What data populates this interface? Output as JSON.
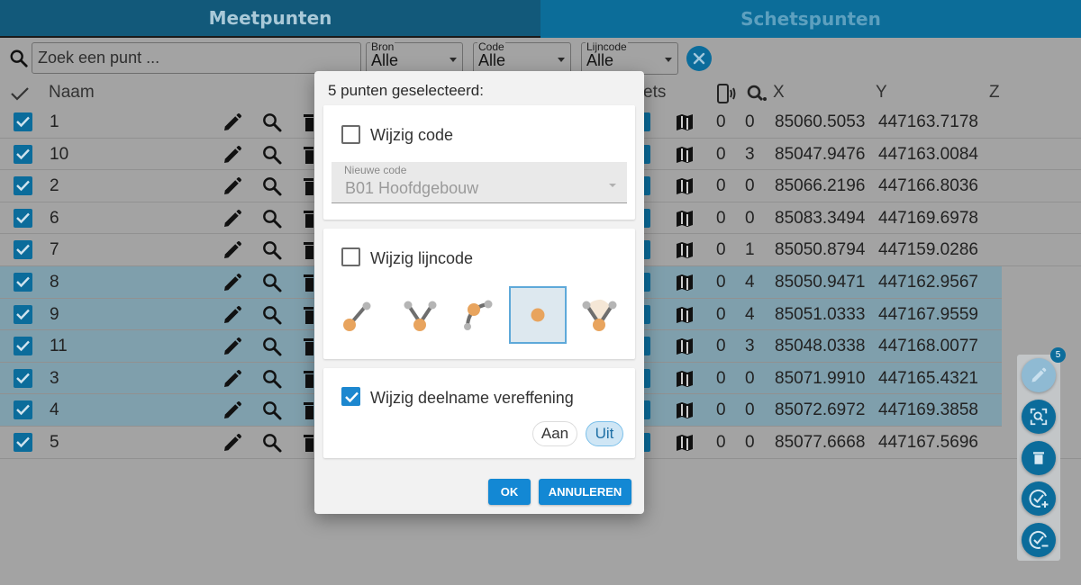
{
  "tabs": [
    {
      "label": "Meetpunten",
      "active": true
    },
    {
      "label": "Schetspunten",
      "active": false
    }
  ],
  "filters": {
    "search_placeholder": "Zoek een punt ...",
    "bron": {
      "label": "Bron",
      "value": "Alle"
    },
    "code": {
      "label": "Code",
      "value": "Alle"
    },
    "lijncode": {
      "label": "Lijncode",
      "value": "Alle"
    }
  },
  "table": {
    "headers": {
      "naam": "Naam",
      "schets_partial": "ets",
      "x": "X",
      "y": "Y",
      "z": "Z"
    },
    "rows": [
      {
        "naam": "1",
        "c0": "0",
        "c1": "0",
        "x": "85060.5053",
        "y": "447163.7178",
        "selected": false
      },
      {
        "naam": "10",
        "c0": "0",
        "c1": "3",
        "x": "85047.9476",
        "y": "447163.0084",
        "selected": false
      },
      {
        "naam": "2",
        "c0": "0",
        "c1": "0",
        "x": "85066.2196",
        "y": "447166.8036",
        "selected": false
      },
      {
        "naam": "6",
        "c0": "0",
        "c1": "0",
        "x": "85083.3494",
        "y": "447169.6978",
        "selected": false
      },
      {
        "naam": "7",
        "c0": "0",
        "c1": "1",
        "x": "85050.8794",
        "y": "447159.0286",
        "selected": false
      },
      {
        "naam": "8",
        "c0": "0",
        "c1": "4",
        "x": "85050.9471",
        "y": "447162.9567",
        "selected": true
      },
      {
        "naam": "9",
        "c0": "0",
        "c1": "4",
        "x": "85051.0333",
        "y": "447167.9559",
        "selected": true
      },
      {
        "naam": "11",
        "c0": "0",
        "c1": "3",
        "x": "85048.0338",
        "y": "447168.0077",
        "selected": true
      },
      {
        "naam": "3",
        "c0": "0",
        "c1": "0",
        "x": "85071.9910",
        "y": "447165.4321",
        "selected": true
      },
      {
        "naam": "4",
        "c0": "0",
        "c1": "0",
        "x": "85072.6972",
        "y": "447169.3858",
        "selected": true
      },
      {
        "naam": "5",
        "c0": "0",
        "c1": "0",
        "x": "85077.6668",
        "y": "447167.5696",
        "selected": false
      }
    ]
  },
  "dialog": {
    "title": "5 punten geselecteerd:",
    "wijzig_code": {
      "label": "Wijzig code",
      "checked": false
    },
    "nieuwe_code": {
      "label": "Nieuwe code",
      "value": "B01 Hoofdgebouw"
    },
    "wijzig_lijncode": {
      "label": "Wijzig lijncode",
      "checked": false
    },
    "lijncode_options": [
      "line-end-icon",
      "line-middle-icon",
      "arc-icon",
      "point-icon",
      "fan-icon"
    ],
    "lijncode_selected": "point-icon",
    "wijzig_deelname": {
      "label": "Wijzig deelname vereffening",
      "checked": true
    },
    "toggle": {
      "aan": "Aan",
      "uit": "Uit",
      "selected": "Uit"
    },
    "ok_label": "OK",
    "cancel_label": "ANNULEREN"
  },
  "fab": {
    "badge": "5"
  },
  "colors": {
    "accent": "#0b6c9b",
    "dialog_button": "#1388d4",
    "point_orange": "#e8a45e"
  }
}
